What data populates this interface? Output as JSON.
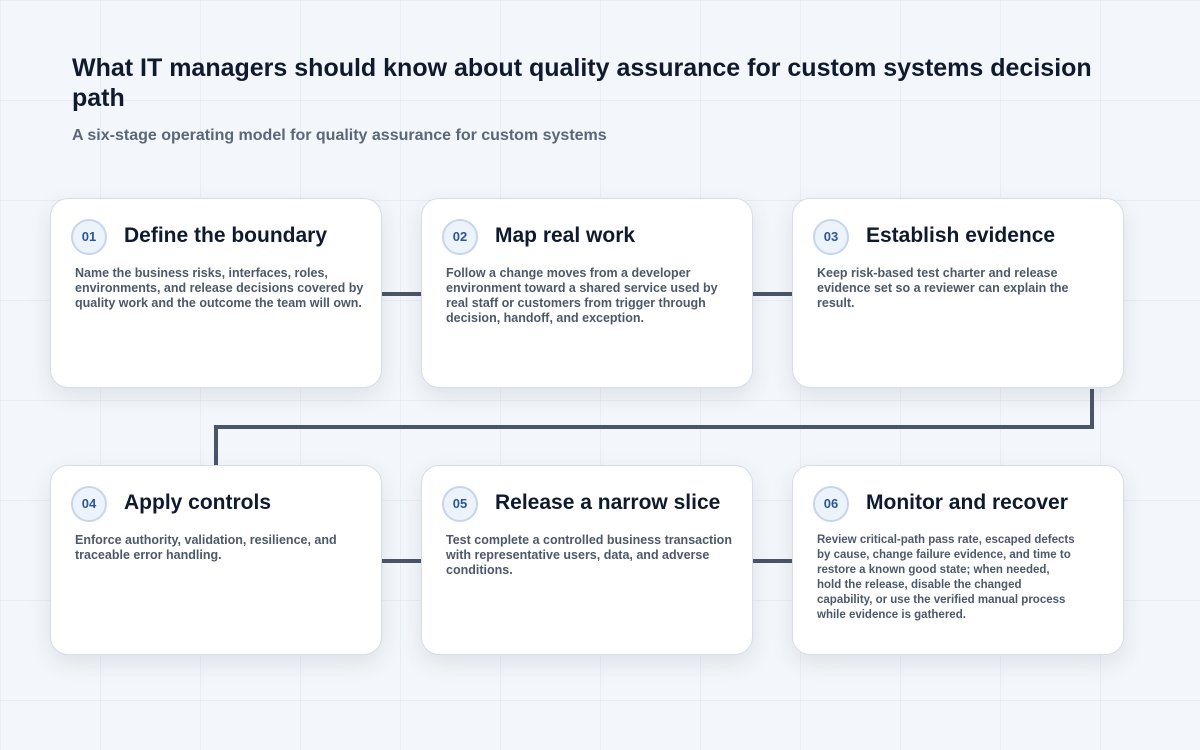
{
  "header": {
    "title": "What IT managers should know about quality assurance for custom systems decision path",
    "subtitle": "A six-stage operating model for quality assurance for custom systems"
  },
  "stages": [
    {
      "number": "01",
      "title": "Define the boundary",
      "body": "Name the business risks, interfaces, roles, environments, and release decisions covered by quality work and the outcome the team will own."
    },
    {
      "number": "02",
      "title": "Map real work",
      "body": "Follow a change moves from a developer environment toward a shared service used by real staff or customers from trigger through decision, handoff, and exception."
    },
    {
      "number": "03",
      "title": "Establish evidence",
      "body": "Keep risk-based test charter and release evidence set so a reviewer can explain the result."
    },
    {
      "number": "04",
      "title": "Apply controls",
      "body": "Enforce authority, validation, resilience, and traceable error handling."
    },
    {
      "number": "05",
      "title": "Release a narrow slice",
      "body": "Test complete a controlled business transaction with representative users, data, and adverse conditions."
    },
    {
      "number": "06",
      "title": "Monitor and recover",
      "body": "Review critical-path pass rate, escaped defects by cause, change failure evidence, and time to restore a known good state; when needed, hold the release, disable the changed capability, or use the verified manual process while evidence is gathered."
    }
  ],
  "colors": {
    "connector": "#4a5568",
    "badge_text": "#2c5797",
    "badge_fill": "#edf3fb"
  }
}
